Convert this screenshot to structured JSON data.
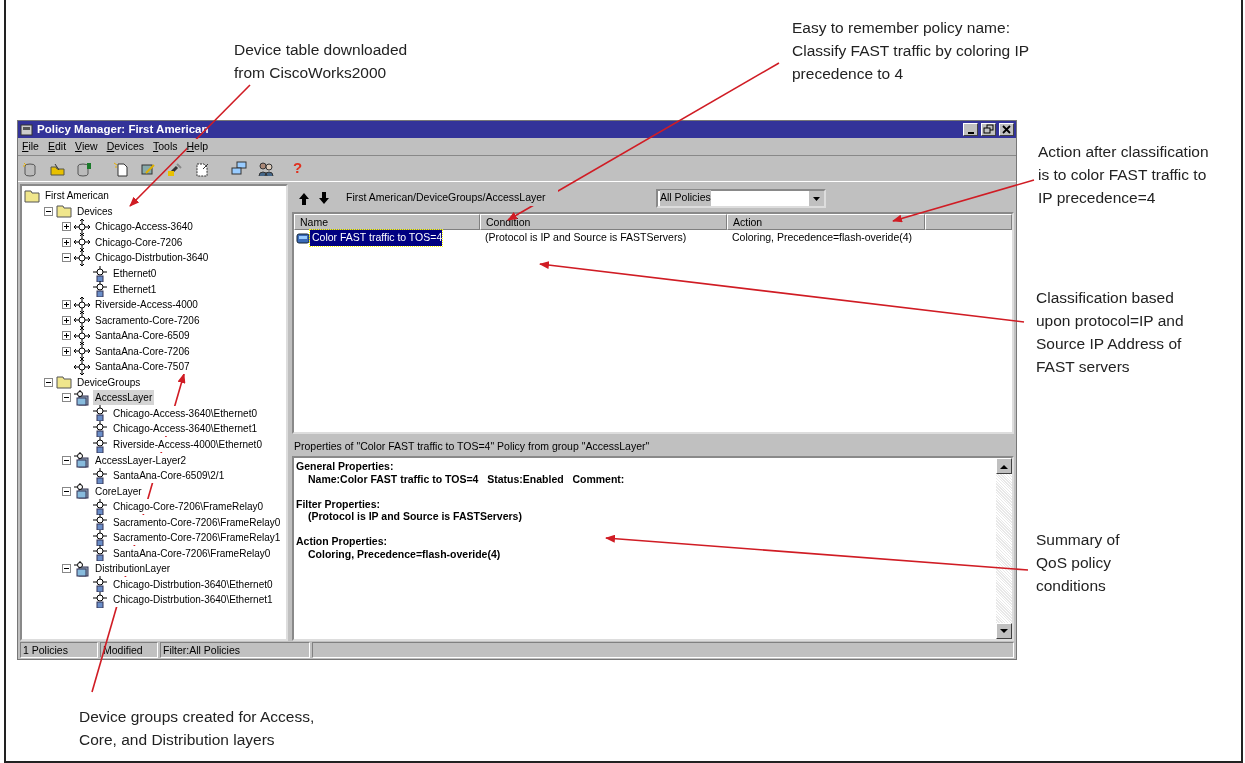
{
  "annotations": [
    {
      "text": "Device table downloaded\nfrom CiscoWorks2000"
    },
    {
      "text": "Easy to remember policy name:\nClassify FAST traffic by coloring IP\nprecedence to 4"
    },
    {
      "text": "Action after classification\nis to color FAST traffic to\nIP precedence=4"
    },
    {
      "text": "Classification based\nupon protocol=IP and\nSource IP Address of\nFAST servers"
    },
    {
      "text": "Summary of\nQoS policy\nconditions"
    },
    {
      "text": "Device groups created for Access,\nCore, and Distribution layers"
    }
  ],
  "window": {
    "title": "Policy Manager: First American"
  },
  "menu": [
    "File",
    "Edit",
    "View",
    "Devices",
    "Tools",
    "Help"
  ],
  "toolbar": {
    "help_glyph": "?"
  },
  "tree": [
    {
      "label": "First American",
      "kind": "folder",
      "selected": false,
      "children": [
        {
          "label": "Devices",
          "kind": "folder",
          "expanded": true,
          "selected": false,
          "children": [
            {
              "label": "Chicago-Access-3640",
              "kind": "device",
              "expanded": false,
              "selected": false
            },
            {
              "label": "Chicago-Core-7206",
              "kind": "device",
              "expanded": false,
              "selected": false
            },
            {
              "label": "Chicago-Distrbution-3640",
              "kind": "device",
              "expanded": true,
              "selected": false,
              "children": [
                {
                  "label": "Ethernet0",
                  "kind": "interface",
                  "selected": false
                },
                {
                  "label": "Ethernet1",
                  "kind": "interface",
                  "selected": false
                }
              ]
            },
            {
              "label": "Riverside-Access-4000",
              "kind": "device",
              "expanded": false,
              "selected": false
            },
            {
              "label": "Sacramento-Core-7206",
              "kind": "device",
              "expanded": false,
              "selected": false
            },
            {
              "label": "SantaAna-Core-6509",
              "kind": "device",
              "expanded": false,
              "selected": false
            },
            {
              "label": "SantaAna-Core-7206",
              "kind": "device",
              "expanded": false,
              "selected": false
            },
            {
              "label": "SantaAna-Core-7507",
              "kind": "device",
              "selected": false
            }
          ]
        },
        {
          "label": "DeviceGroups",
          "kind": "folder",
          "expanded": true,
          "selected": false,
          "children": [
            {
              "label": "AccessLayer",
              "kind": "group",
              "expanded": true,
              "selected": true,
              "children": [
                {
                  "label": "Chicago-Access-3640\\Ethernet0",
                  "kind": "interface",
                  "selected": false
                },
                {
                  "label": "Chicago-Access-3640\\Ethernet1",
                  "kind": "interface",
                  "selected": false
                },
                {
                  "label": "Riverside-Access-4000\\Ethernet0",
                  "kind": "interface",
                  "selected": false
                }
              ]
            },
            {
              "label": "AccessLayer-Layer2",
              "kind": "group",
              "expanded": true,
              "selected": false,
              "children": [
                {
                  "label": "SantaAna-Core-6509\\2/1",
                  "kind": "interface",
                  "selected": false
                }
              ]
            },
            {
              "label": "CoreLayer",
              "kind": "group",
              "expanded": true,
              "selected": false,
              "children": [
                {
                  "label": "Chicago-Core-7206\\FrameRelay0",
                  "kind": "interface",
                  "selected": false
                },
                {
                  "label": "Sacramento-Core-7206\\FrameRelay0",
                  "kind": "interface",
                  "selected": false
                },
                {
                  "label": "Sacramento-Core-7206\\FrameRelay1",
                  "kind": "interface",
                  "selected": false
                },
                {
                  "label": "SantaAna-Core-7206\\FrameRelay0",
                  "kind": "interface",
                  "selected": false
                }
              ]
            },
            {
              "label": "DistributionLayer",
              "kind": "group",
              "expanded": true,
              "selected": false,
              "children": [
                {
                  "label": "Chicago-Distrbution-3640\\Ethernet0",
                  "kind": "interface",
                  "selected": false
                },
                {
                  "label": "Chicago-Distrbution-3640\\Ethernet1",
                  "kind": "interface",
                  "selected": false
                }
              ]
            }
          ]
        }
      ]
    }
  ],
  "policy_pane": {
    "path": "First American/DeviceGroups/AccessLayer",
    "filter": {
      "value": "All Policies"
    },
    "columns": [
      "Name",
      "Condition",
      "Action"
    ],
    "rows": [
      {
        "name": "Color FAST traffic to TOS=4",
        "condition": "(Protocol is IP and Source is FASTServers)",
        "action": "Coloring, Precedence=flash-overide(4)",
        "selected": true
      }
    ]
  },
  "properties": {
    "caption": "Properties of \"Color FAST traffic to TOS=4\" Policy from group \"AccessLayer\"",
    "sections": [
      {
        "heading": "General Properties:",
        "body": "Name:Color FAST traffic to TOS=4   Status:Enabled   Comment:"
      },
      {
        "heading": "Filter Properties:",
        "body": "(Protocol is IP and Source is FASTServers)"
      },
      {
        "heading": "Action Properties:",
        "body": "Coloring, Precedence=flash-overide(4)"
      }
    ]
  },
  "status_bar": [
    "1 Policies",
    "Modified",
    "Filter:All Policies"
  ]
}
